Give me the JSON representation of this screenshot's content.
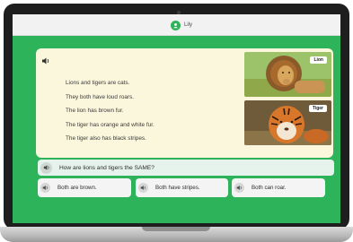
{
  "header": {
    "user_name": "Lily"
  },
  "passage": {
    "lines": [
      "Lions and tigers are cats.",
      "They both have loud roars.",
      "The lion has brown fur.",
      "The tiger has orange and white fur.",
      "The tiger also has black stripes."
    ]
  },
  "pictures": {
    "lion_label": "Lion",
    "tiger_label": "Tiger"
  },
  "question": {
    "text": "How are lions and tigers the SAME?"
  },
  "answers": [
    "Both are brown.",
    "Both have stripes.",
    "Both can roar."
  ],
  "icons": {
    "audio": "speaker-icon",
    "user": "avatar-icon"
  },
  "colors": {
    "screen_background": "#2db45a",
    "card_background": "#fbf7dc",
    "question_background": "#e6f2ec",
    "answer_background": "#f4f4f4"
  }
}
